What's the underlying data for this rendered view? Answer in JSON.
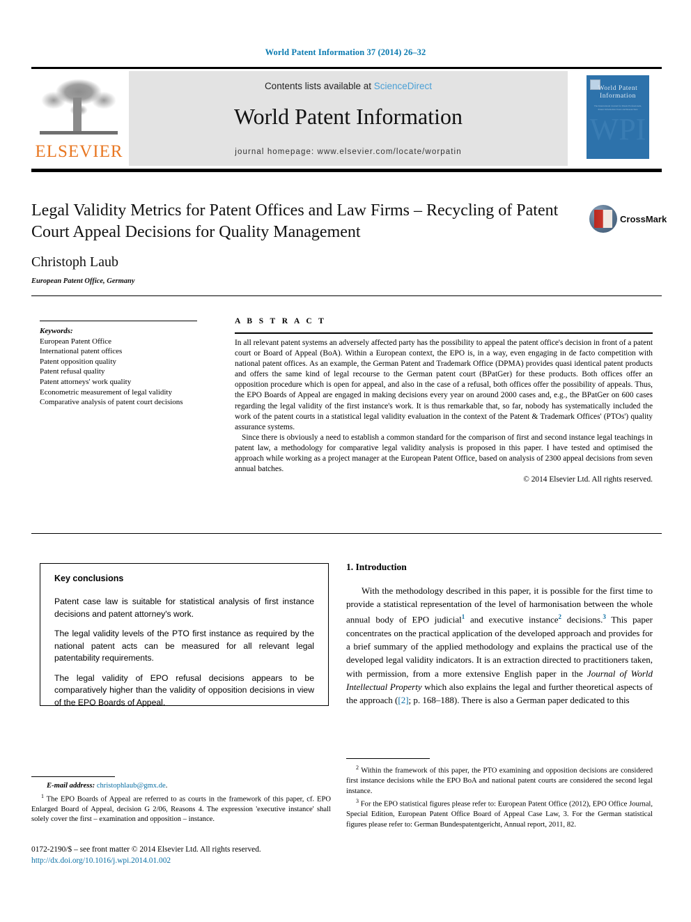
{
  "running_head": "World Patent Information 37 (2014) 26–32",
  "masthead": {
    "publisher_name": "ELSEVIER",
    "contents_prefix": "Contents lists available at ",
    "sciencedirect": "ScienceDirect",
    "journal_title": "World Patent Information",
    "homepage": "journal homepage: www.elsevier.com/locate/worpatin",
    "cover": {
      "title": "World Patent Information",
      "subtitle": "The International Journal for Patent Professionals, Patent Information Users and Researchers",
      "monogram": "WPI"
    }
  },
  "article": {
    "title": "Legal Validity Metrics for Patent Offices and Law Firms – Recycling of Patent Court Appeal Decisions for Quality Management",
    "author": "Christoph Laub",
    "affiliation": "European Patent Office, Germany",
    "crossmark_label": "CrossMark"
  },
  "keywords": {
    "label": "Keywords:",
    "items": [
      "European Patent Office",
      "International patent offices",
      "Patent opposition quality",
      "Patent refusal quality",
      "Patent attorneys' work quality",
      "Econometric measurement of legal validity",
      "Comparative analysis of patent court decisions"
    ]
  },
  "abstract": {
    "heading": "A B S T R A C T",
    "paragraphs": [
      "In all relevant patent systems an adversely affected party has the possibility to appeal the patent office's decision in front of a patent court or Board of Appeal (BoA). Within a European context, the EPO is, in a way, even engaging in de facto competition with national patent offices. As an example, the German Patent and Trademark Office (DPMA) provides quasi identical patent products and offers the same kind of legal recourse to the German patent court (BPatGer) for these products. Both offices offer an opposition procedure which is open for appeal, and also in the case of a refusal, both offices offer the possibility of appeals. Thus, the EPO Boards of Appeal are engaged in making decisions every year on around 2000 cases and, e.g., the BPatGer on 600 cases regarding the legal validity of the first instance's work. It is thus remarkable that, so far, nobody has systematically included the work of the patent courts in a statistical legal validity evaluation in the context of the Patent & Trademark Offices' (PTOs') quality assurance systems.",
      "Since there is obviously a need to establish a common standard for the comparison of first and second instance legal teachings in patent law, a methodology for comparative legal validity analysis is proposed in this paper. I have tested and optimised the approach while working as a project manager at the European Patent Office, based on analysis of 2300 appeal decisions from seven annual batches."
    ],
    "copyright": "© 2014 Elsevier Ltd. All rights reserved."
  },
  "key_conclusions": {
    "title": "Key conclusions",
    "items": [
      "Patent case law is suitable for statistical analysis of first instance decisions and patent attorney's work.",
      "The legal validity levels of the PTO first instance as required by the national patent acts can be measured for all relevant legal patentability requirements.",
      "The legal validity of EPO refusal decisions appears to be comparatively higher than the validity of opposition decisions in view of the EPO Boards of Appeal."
    ]
  },
  "introduction": {
    "heading": "1. Introduction",
    "text_1": "With the methodology described in this paper, it is possible for the first time to provide a statistical representation of the level of harmonisation between the whole annual body of EPO judicial",
    "sup_1": "1",
    "text_2": " and executive instance",
    "sup_2": "2",
    "text_3": " decisions.",
    "sup_3": "3",
    "text_4": " This paper concentrates on the practical application of the developed approach and provides for a brief summary of the applied methodology and explains the practical use of the developed legal validity indicators. It is an extraction directed to practitioners taken, with permission, from a more extensive English paper in the ",
    "journal_italic": "Journal of World Intellectual Property",
    "text_5": " which also explains the legal and further theoretical aspects of the approach (",
    "ref_link": "[2]",
    "text_6": "; p. 168–188). There is also a German paper dedicated to this"
  },
  "footnotes_left": {
    "email_label": "E-mail address:",
    "email": "christophlaub@gmx.de",
    "email_trailing": ".",
    "fn1_marker": "1",
    "fn1_text": "The EPO Boards of Appeal are referred to as courts in the framework of this paper, cf. EPO Enlarged Board of Appeal, decision G 2/06, Reasons 4. The expression 'executive instance' shall solely cover the first – examination and opposition – instance."
  },
  "footnotes_right": {
    "fn2_marker": "2",
    "fn2_text": "Within the framework of this paper, the PTO examining and opposition decisions are considered first instance decisions while the EPO BoA and national patent courts are considered the second legal instance.",
    "fn3_marker": "3",
    "fn3_text": "For the EPO statistical figures please refer to: European Patent Office (2012), EPO Office Journal, Special Edition, European Patent Office Board of Appeal Case Law, 3. For the German statistical figures please refer to: German Bundespatentgericht, Annual report, 2011, 82."
  },
  "footer": {
    "issn_line": "0172-2190/$ – see front matter © 2014 Elsevier Ltd. All rights reserved.",
    "doi": "http://dx.doi.org/10.1016/j.wpi.2014.01.002"
  },
  "colors": {
    "link_blue": "#0b6fa4",
    "sciencedirect_blue": "#4a9fd5",
    "elsevier_orange": "#e87722",
    "cover_blue": "#2d72ab"
  }
}
